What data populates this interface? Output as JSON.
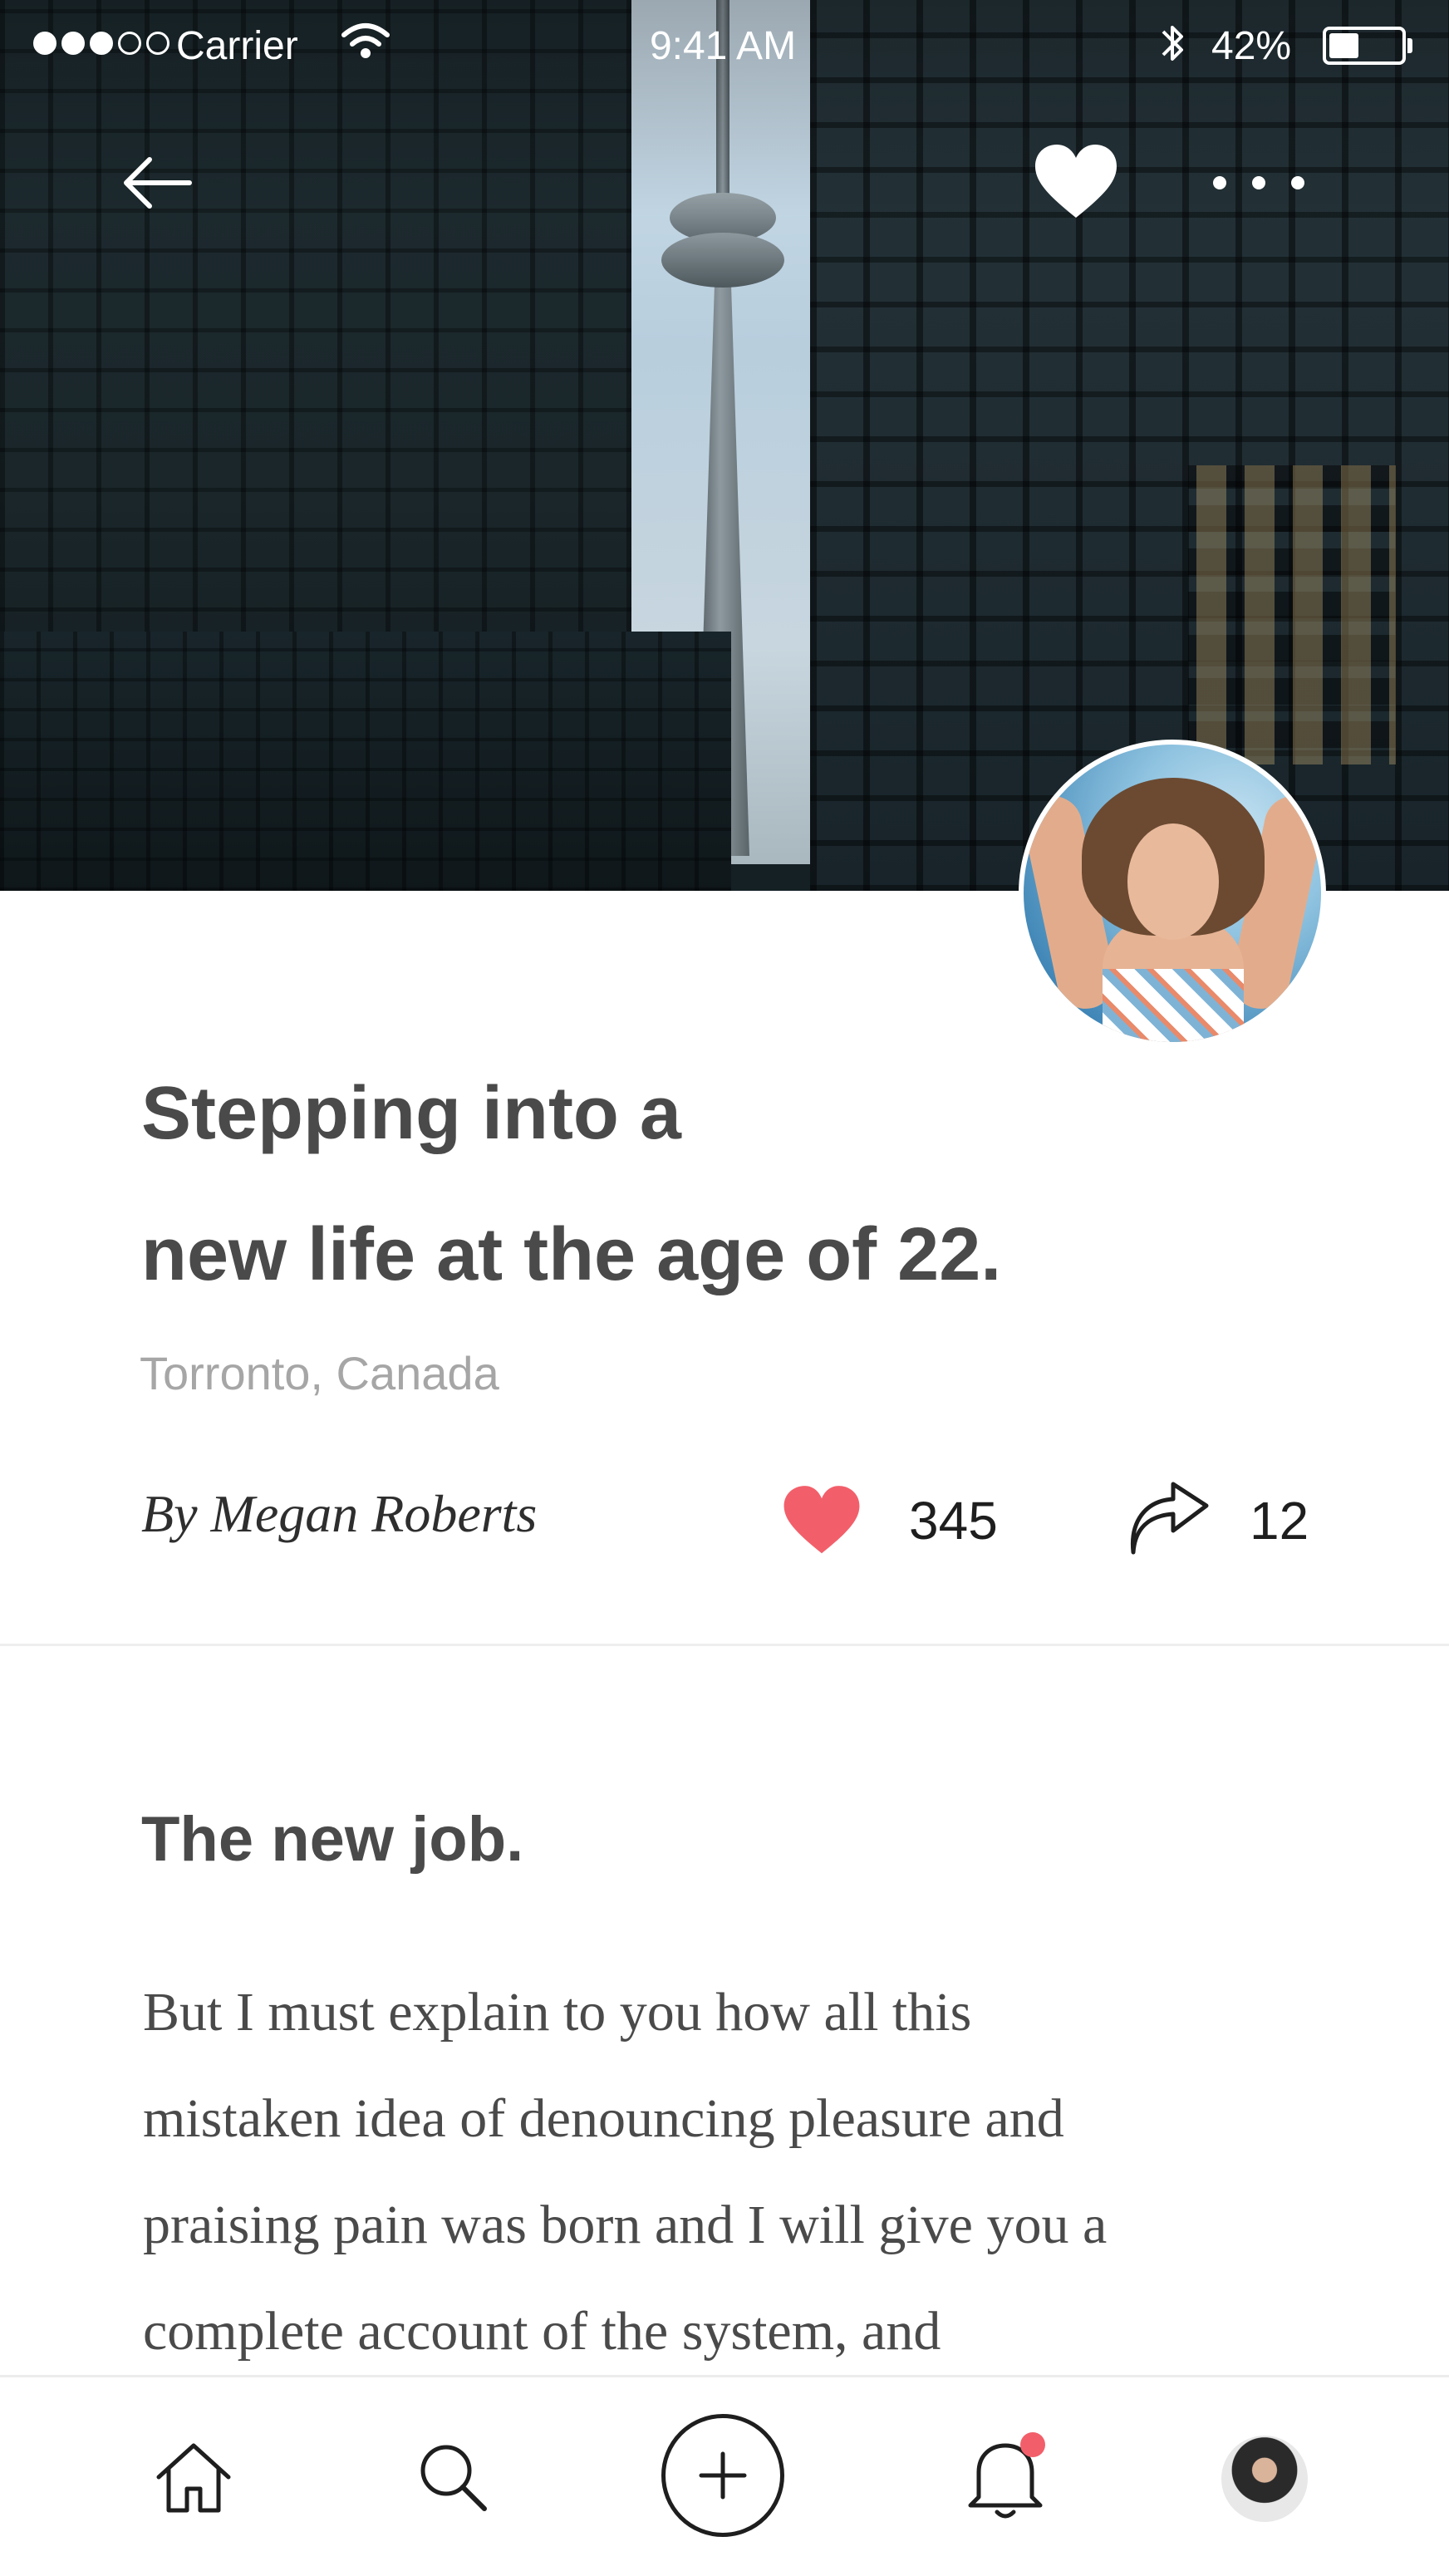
{
  "status_bar": {
    "carrier": "Carrier",
    "time": "9:41 AM",
    "battery_percent": "42%",
    "battery_level": 0.42,
    "signal_bars_filled": 3,
    "signal_bars_total": 5
  },
  "nav": {
    "back_icon": "arrow-left-icon",
    "like_icon": "heart-filled-icon",
    "more_icon": "more-horizontal-icon"
  },
  "article": {
    "title_line1": "Stepping into a",
    "title_line2": "new life at the age of 22.",
    "location": "Torronto, Canada",
    "byline": "By Megan Roberts",
    "likes_count": "345",
    "shares_count": "12",
    "section_title": "The new job.",
    "body_lines": [
      "But I must explain to you how all this",
      "mistaken idea of denouncing pleasure and",
      "praising pain was born and I will give you a",
      "complete account of the system, and"
    ]
  },
  "tab_bar": {
    "items": [
      "home-icon",
      "search-icon",
      "plus-icon",
      "bell-icon",
      "profile-avatar"
    ],
    "notification_badge": true
  },
  "colors": {
    "accent_heart": "#f25f6a",
    "title_text": "#4a4a4a",
    "muted_text": "#a6a6a6",
    "icon_dark": "#1e1e1e"
  }
}
